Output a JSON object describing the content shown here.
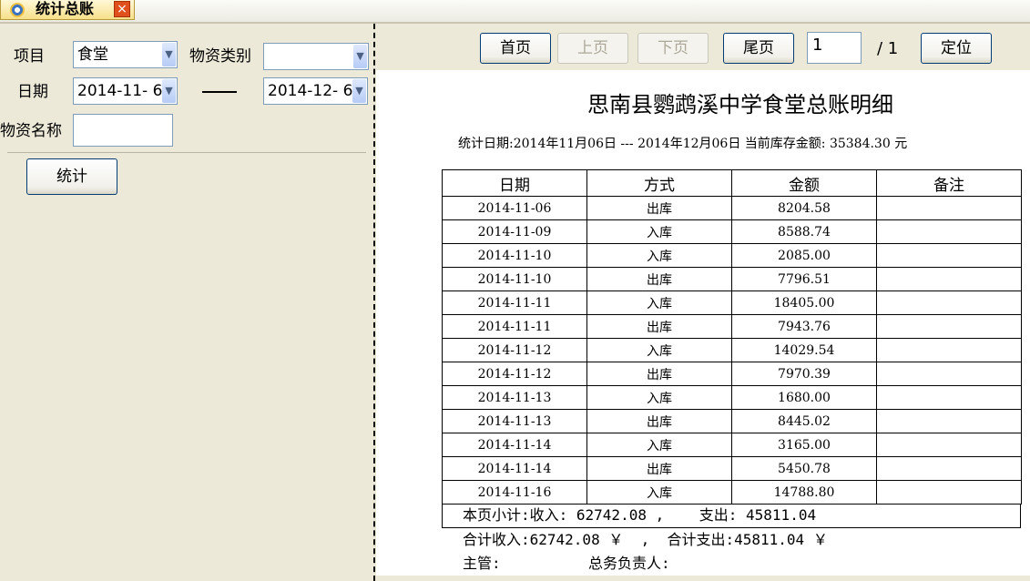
{
  "tab": {
    "title": "统计总账",
    "close_glyph": "×"
  },
  "filters": {
    "project_label": "项目",
    "project_value": "食堂",
    "category_label": "物资类别",
    "category_value": "",
    "date_label": "日期",
    "date_from": "2014-11- 6",
    "date_to": "2014-12- 6",
    "name_label": "物资名称",
    "name_value": "",
    "range_separator": "——",
    "stat_button": "统计"
  },
  "pager": {
    "first": "首页",
    "prev": "上页",
    "next": "下页",
    "last": "尾页",
    "page_value": "1",
    "total_pages": "/ 1",
    "goto": "定位"
  },
  "report": {
    "title": "思南县鹦鹉溪中学食堂总账明细",
    "info": "统计日期:2014年11月06日 --- 2014年12月06日    当前库存金额: 35384.30 元",
    "columns": [
      "日期",
      "方式",
      "金额",
      "备注"
    ],
    "rows": [
      [
        "2014-11-06",
        "出库",
        "8204.58",
        ""
      ],
      [
        "2014-11-09",
        "入库",
        "8588.74",
        ""
      ],
      [
        "2014-11-10",
        "入库",
        "2085.00",
        ""
      ],
      [
        "2014-11-10",
        "出库",
        "7796.51",
        ""
      ],
      [
        "2014-11-11",
        "入库",
        "18405.00",
        ""
      ],
      [
        "2014-11-11",
        "出库",
        "7943.76",
        ""
      ],
      [
        "2014-11-12",
        "入库",
        "14029.54",
        ""
      ],
      [
        "2014-11-12",
        "出库",
        "7970.39",
        ""
      ],
      [
        "2014-11-13",
        "入库",
        "1680.00",
        ""
      ],
      [
        "2014-11-13",
        "出库",
        "8445.02",
        ""
      ],
      [
        "2014-11-14",
        "入库",
        "3165.00",
        ""
      ],
      [
        "2014-11-14",
        "出库",
        "5450.78",
        ""
      ],
      [
        "2014-11-16",
        "入库",
        "14788.80",
        ""
      ]
    ],
    "subtotal": "本页小计:收入: 62742.08 ,    支出: 45811.04",
    "total": "合计收入:62742.08 ￥  ,  合计支出:45811.04 ￥",
    "sign": "主管:          总务负责人:"
  }
}
